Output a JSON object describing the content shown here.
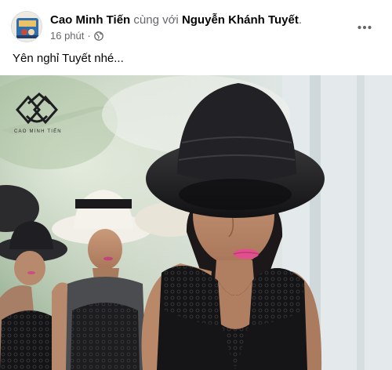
{
  "post": {
    "author": "Cao Minh Tiến",
    "with_text": " cùng với ",
    "tagged": "Nguyễn Khánh Tuyết",
    "tagged_suffix": ".",
    "time": "16 phút",
    "separator": "·",
    "privacy_icon": "globe-icon",
    "more_icon": "more-options-icon",
    "caption": "Yên nghỉ Tuyết nhé...",
    "photo": {
      "watermark_text": "CAO MINH TIẾN",
      "watermark_logo": "cao-minh-tien-logo"
    }
  }
}
